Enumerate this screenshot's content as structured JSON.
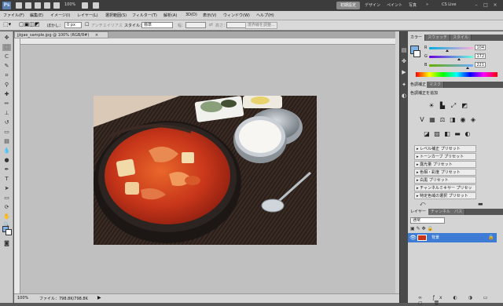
{
  "app": {
    "logo": "Ps",
    "zoom": "100%",
    "workspaces": [
      "基本機能",
      "デザイン",
      "ペイント",
      "写真"
    ],
    "active_workspace": "初期設定",
    "more": "»",
    "cs_live": "CS Live"
  },
  "menu": [
    "ファイル(F)",
    "編集(E)",
    "イメージ(I)",
    "レイヤー(L)",
    "選択範囲(S)",
    "フィルター(T)",
    "解析(A)",
    "3D(D)",
    "表示(V)",
    "ウィンドウ(W)",
    "ヘルプ(H)"
  ],
  "options": {
    "feather_label": "ぼかし：",
    "feather_value": "0 px",
    "antialias_label": "アンチエイリアス",
    "style_label": "スタイル：",
    "style_value": "標準",
    "width_label": "幅：",
    "height_label": "高さ：",
    "refine_button": "境界線を調整..."
  },
  "document": {
    "tab_title": "jjigae_sample.jpg @ 100% (RGB/8#)",
    "close": "×",
    "zoom": "100%",
    "file_info": "ファイル：798.8K/798.8K"
  },
  "panels": {
    "color_tabs": [
      "カラー",
      "スウォッチ",
      "スタイル"
    ],
    "rgb": [
      {
        "label": "R",
        "value": "104",
        "level": 0.41
      },
      {
        "label": "G",
        "value": "172",
        "level": 0.67
      },
      {
        "label": "B",
        "value": "221",
        "level": 0.87
      }
    ],
    "adjust_tabs": [
      "色調補正",
      "マスク"
    ],
    "adjust_title": "色調補正を追加",
    "presets": [
      "レベル補正 プリセット",
      "トーンカーブ プリセット",
      "露光量 プリセット",
      "色相・彩度 プリセット",
      "白黒 プリセット",
      "チャンネルミキサー プリセット",
      "特定色域の選択 プリセット"
    ],
    "layer_tabs": [
      "レイヤー",
      "チャンネル",
      "パス"
    ],
    "blend_mode": "通常",
    "layer_name": "背景"
  },
  "colors": {
    "accent": "#3d7bd4",
    "foreground": "#7fb2e5",
    "background": "#ffffff"
  }
}
